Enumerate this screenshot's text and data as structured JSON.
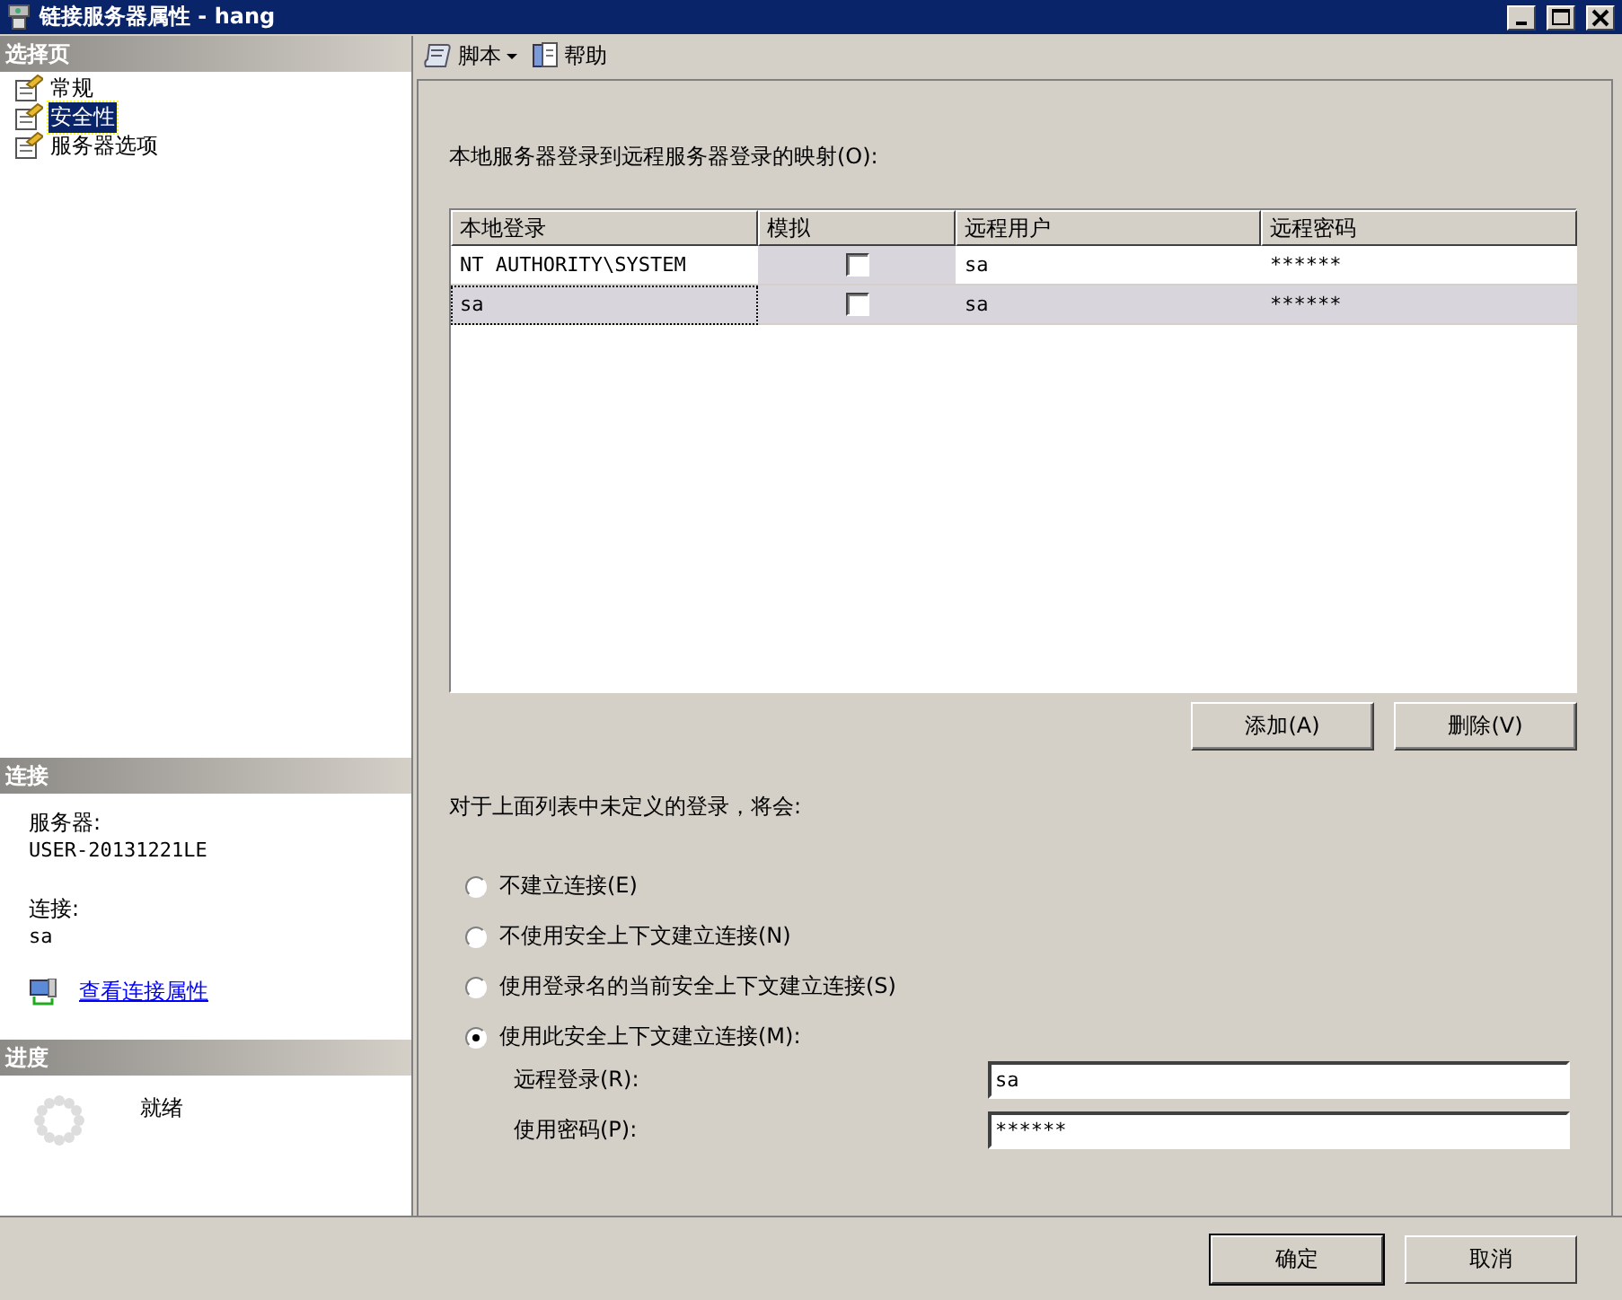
{
  "window": {
    "title": "链接服务器属性 - hang"
  },
  "select_page": {
    "header": "选择页",
    "items": [
      {
        "label": "常规",
        "selected": false
      },
      {
        "label": "安全性",
        "selected": true
      },
      {
        "label": "服务器选项",
        "selected": false
      }
    ]
  },
  "connection": {
    "header": "连接",
    "server_label": "服务器:",
    "server": "USER-20131221LE",
    "connection_label": "连接:",
    "connection": "sa",
    "link": "查看连接属性"
  },
  "progress": {
    "header": "进度",
    "status": "就绪"
  },
  "toolbar": {
    "script": "脚本",
    "help": "帮助"
  },
  "mapping": {
    "label": "本地服务器登录到远程服务器登录的映射(O):",
    "columns": [
      "本地登录",
      "模拟",
      "远程用户",
      "远程密码"
    ],
    "rows": [
      {
        "local_login": "NT AUTHORITY\\SYSTEM",
        "impersonate": false,
        "remote_user": "sa",
        "remote_password": "******",
        "selected": false
      },
      {
        "local_login": "sa",
        "impersonate": false,
        "remote_user": "sa",
        "remote_password": "******",
        "selected": true
      }
    ],
    "buttons": [
      "添加(A)",
      "删除(V)"
    ]
  },
  "undefined_logins": {
    "label": "对于上面列表中未定义的登录，将会:",
    "options": [
      {
        "label": "不建立连接(E)",
        "selected": false
      },
      {
        "label": "不使用安全上下文建立连接(N)",
        "selected": false
      },
      {
        "label": "使用登录名的当前安全上下文建立连接(S)",
        "selected": false
      },
      {
        "label": "使用此安全上下文建立连接(M):",
        "selected": true
      }
    ],
    "fields": [
      {
        "label": "远程登录(R):",
        "value": "sa"
      },
      {
        "label": "使用密码(P):",
        "value": "******"
      }
    ]
  },
  "footer_buttons": [
    "确定",
    "取消"
  ]
}
